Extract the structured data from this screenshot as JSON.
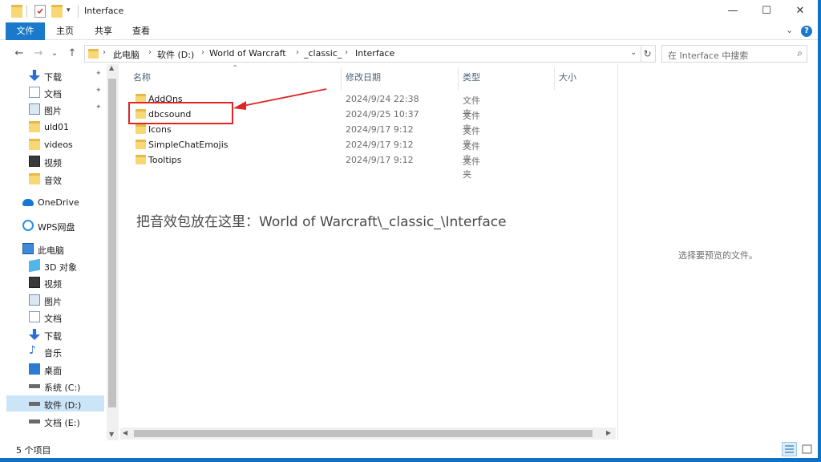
{
  "window": {
    "title": "Interface",
    "quick_access": [
      "folder-icon",
      "properties-icon",
      "new-folder-icon",
      "customize-dropdown-icon"
    ],
    "controls": {
      "minimize": "—",
      "maximize": "☐",
      "close": "✕"
    }
  },
  "ribbon": {
    "tabs": [
      "文件",
      "主页",
      "共享",
      "查看"
    ],
    "expand_glyph": "⌄",
    "help_glyph": "?"
  },
  "nav": {
    "back_glyph": "←",
    "forward_glyph": "→",
    "recent_glyph": "⌄",
    "up_glyph": "↑",
    "breadcrumb": [
      "此电脑",
      "软件 (D:)",
      "World of Warcraft",
      "_classic_",
      "Interface"
    ],
    "separator": "›",
    "dropdown_glyph": "⌄",
    "refresh_glyph": "↻",
    "search_placeholder": "在 Interface 中搜索",
    "search_glyph": "⌕"
  },
  "sidebar": {
    "items": [
      {
        "label": "下载",
        "icon": "download-icon",
        "pinned": true
      },
      {
        "label": "文档",
        "icon": "document-icon",
        "pinned": true
      },
      {
        "label": "图片",
        "icon": "picture-icon",
        "pinned": true
      },
      {
        "label": "uld01",
        "icon": "folder-icon",
        "pinned": false
      },
      {
        "label": "videos",
        "icon": "folder-icon",
        "pinned": false
      },
      {
        "label": "视频",
        "icon": "video-icon",
        "pinned": false
      },
      {
        "label": "音效",
        "icon": "folder-icon",
        "pinned": false
      },
      {
        "label": "OneDrive",
        "icon": "onedrive-icon",
        "pinned": false
      },
      {
        "label": "WPS网盘",
        "icon": "cloud-icon",
        "pinned": false
      },
      {
        "label": "此电脑",
        "icon": "computer-icon",
        "pinned": false
      },
      {
        "label": "3D 对象",
        "icon": "3d-objects-icon",
        "pinned": false
      },
      {
        "label": "视频",
        "icon": "video-icon",
        "pinned": false
      },
      {
        "label": "图片",
        "icon": "picture-icon",
        "pinned": false
      },
      {
        "label": "文档",
        "icon": "document-icon",
        "pinned": false
      },
      {
        "label": "下载",
        "icon": "download-icon",
        "pinned": false
      },
      {
        "label": "音乐",
        "icon": "music-icon",
        "pinned": false
      },
      {
        "label": "桌面",
        "icon": "desktop-icon",
        "pinned": false
      },
      {
        "label": "系统 (C:)",
        "icon": "drive-icon",
        "pinned": false
      },
      {
        "label": "软件 (D:)",
        "icon": "drive-icon",
        "pinned": false,
        "selected": true
      },
      {
        "label": "文档 (E:)",
        "icon": "drive-icon",
        "pinned": false
      }
    ],
    "pin_glyph": "📌"
  },
  "list": {
    "columns": [
      "名称",
      "修改日期",
      "类型",
      "大小"
    ],
    "sort_glyph": "⌃",
    "rows": [
      {
        "name": "AddOns",
        "date": "2024/9/24 22:38",
        "type": "文件夹"
      },
      {
        "name": "dbcsound",
        "date": "2024/9/25 10:37",
        "type": "文件夹"
      },
      {
        "name": "Icons",
        "date": "2024/9/17 9:12",
        "type": "文件夹"
      },
      {
        "name": "SimpleChatEmojis",
        "date": "2024/9/17 9:12",
        "type": "文件夹"
      },
      {
        "name": "Tooltips",
        "date": "2024/9/17 9:12",
        "type": "文件夹"
      }
    ],
    "annotation": "把音效包放在这里：World of Warcraft\\_classic_\\Interface"
  },
  "preview": {
    "text": "选择要预览的文件。"
  },
  "status": {
    "item_count": "5 个项目"
  },
  "colors": {
    "accent": "#1979ca",
    "highlight_box": "#e02525",
    "selected": "#cce4f7",
    "folder": "#f8d775"
  }
}
